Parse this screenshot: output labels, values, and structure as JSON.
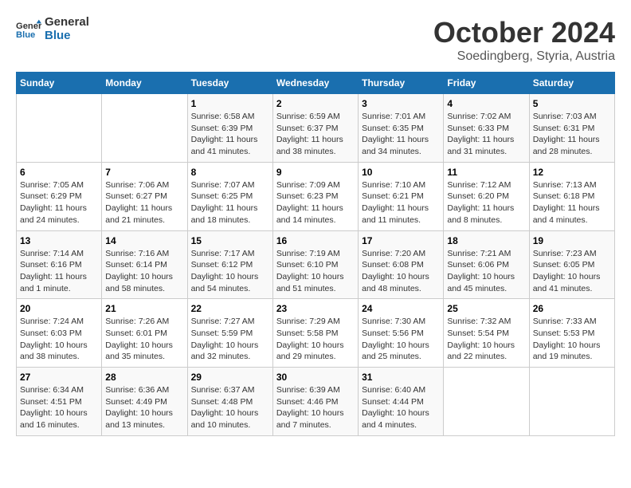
{
  "logo": {
    "line1": "General",
    "line2": "Blue"
  },
  "title": "October 2024",
  "subtitle": "Soedingberg, Styria, Austria",
  "days_header": [
    "Sunday",
    "Monday",
    "Tuesday",
    "Wednesday",
    "Thursday",
    "Friday",
    "Saturday"
  ],
  "weeks": [
    [
      {
        "num": "",
        "detail": ""
      },
      {
        "num": "",
        "detail": ""
      },
      {
        "num": "1",
        "detail": "Sunrise: 6:58 AM\nSunset: 6:39 PM\nDaylight: 11 hours and 41 minutes."
      },
      {
        "num": "2",
        "detail": "Sunrise: 6:59 AM\nSunset: 6:37 PM\nDaylight: 11 hours and 38 minutes."
      },
      {
        "num": "3",
        "detail": "Sunrise: 7:01 AM\nSunset: 6:35 PM\nDaylight: 11 hours and 34 minutes."
      },
      {
        "num": "4",
        "detail": "Sunrise: 7:02 AM\nSunset: 6:33 PM\nDaylight: 11 hours and 31 minutes."
      },
      {
        "num": "5",
        "detail": "Sunrise: 7:03 AM\nSunset: 6:31 PM\nDaylight: 11 hours and 28 minutes."
      }
    ],
    [
      {
        "num": "6",
        "detail": "Sunrise: 7:05 AM\nSunset: 6:29 PM\nDaylight: 11 hours and 24 minutes."
      },
      {
        "num": "7",
        "detail": "Sunrise: 7:06 AM\nSunset: 6:27 PM\nDaylight: 11 hours and 21 minutes."
      },
      {
        "num": "8",
        "detail": "Sunrise: 7:07 AM\nSunset: 6:25 PM\nDaylight: 11 hours and 18 minutes."
      },
      {
        "num": "9",
        "detail": "Sunrise: 7:09 AM\nSunset: 6:23 PM\nDaylight: 11 hours and 14 minutes."
      },
      {
        "num": "10",
        "detail": "Sunrise: 7:10 AM\nSunset: 6:21 PM\nDaylight: 11 hours and 11 minutes."
      },
      {
        "num": "11",
        "detail": "Sunrise: 7:12 AM\nSunset: 6:20 PM\nDaylight: 11 hours and 8 minutes."
      },
      {
        "num": "12",
        "detail": "Sunrise: 7:13 AM\nSunset: 6:18 PM\nDaylight: 11 hours and 4 minutes."
      }
    ],
    [
      {
        "num": "13",
        "detail": "Sunrise: 7:14 AM\nSunset: 6:16 PM\nDaylight: 11 hours and 1 minute."
      },
      {
        "num": "14",
        "detail": "Sunrise: 7:16 AM\nSunset: 6:14 PM\nDaylight: 10 hours and 58 minutes."
      },
      {
        "num": "15",
        "detail": "Sunrise: 7:17 AM\nSunset: 6:12 PM\nDaylight: 10 hours and 54 minutes."
      },
      {
        "num": "16",
        "detail": "Sunrise: 7:19 AM\nSunset: 6:10 PM\nDaylight: 10 hours and 51 minutes."
      },
      {
        "num": "17",
        "detail": "Sunrise: 7:20 AM\nSunset: 6:08 PM\nDaylight: 10 hours and 48 minutes."
      },
      {
        "num": "18",
        "detail": "Sunrise: 7:21 AM\nSunset: 6:06 PM\nDaylight: 10 hours and 45 minutes."
      },
      {
        "num": "19",
        "detail": "Sunrise: 7:23 AM\nSunset: 6:05 PM\nDaylight: 10 hours and 41 minutes."
      }
    ],
    [
      {
        "num": "20",
        "detail": "Sunrise: 7:24 AM\nSunset: 6:03 PM\nDaylight: 10 hours and 38 minutes."
      },
      {
        "num": "21",
        "detail": "Sunrise: 7:26 AM\nSunset: 6:01 PM\nDaylight: 10 hours and 35 minutes."
      },
      {
        "num": "22",
        "detail": "Sunrise: 7:27 AM\nSunset: 5:59 PM\nDaylight: 10 hours and 32 minutes."
      },
      {
        "num": "23",
        "detail": "Sunrise: 7:29 AM\nSunset: 5:58 PM\nDaylight: 10 hours and 29 minutes."
      },
      {
        "num": "24",
        "detail": "Sunrise: 7:30 AM\nSunset: 5:56 PM\nDaylight: 10 hours and 25 minutes."
      },
      {
        "num": "25",
        "detail": "Sunrise: 7:32 AM\nSunset: 5:54 PM\nDaylight: 10 hours and 22 minutes."
      },
      {
        "num": "26",
        "detail": "Sunrise: 7:33 AM\nSunset: 5:53 PM\nDaylight: 10 hours and 19 minutes."
      }
    ],
    [
      {
        "num": "27",
        "detail": "Sunrise: 6:34 AM\nSunset: 4:51 PM\nDaylight: 10 hours and 16 minutes."
      },
      {
        "num": "28",
        "detail": "Sunrise: 6:36 AM\nSunset: 4:49 PM\nDaylight: 10 hours and 13 minutes."
      },
      {
        "num": "29",
        "detail": "Sunrise: 6:37 AM\nSunset: 4:48 PM\nDaylight: 10 hours and 10 minutes."
      },
      {
        "num": "30",
        "detail": "Sunrise: 6:39 AM\nSunset: 4:46 PM\nDaylight: 10 hours and 7 minutes."
      },
      {
        "num": "31",
        "detail": "Sunrise: 6:40 AM\nSunset: 4:44 PM\nDaylight: 10 hours and 4 minutes."
      },
      {
        "num": "",
        "detail": ""
      },
      {
        "num": "",
        "detail": ""
      }
    ]
  ]
}
